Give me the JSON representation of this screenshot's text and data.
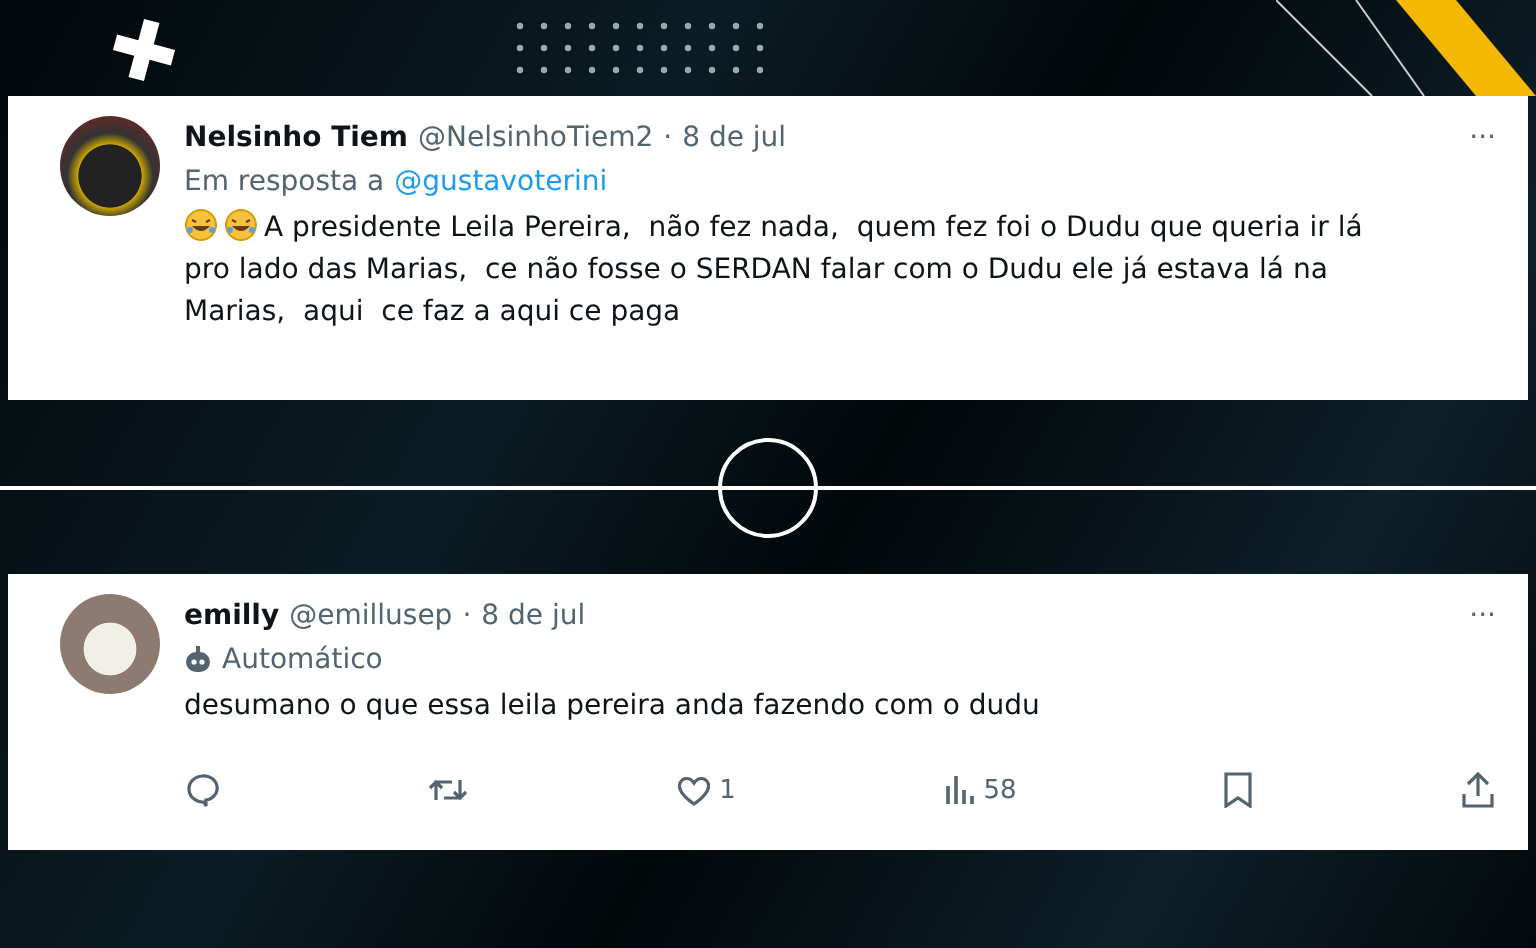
{
  "tweets": [
    {
      "name": "Nelsinho Tiem",
      "handle": "@NelsinhoTiem2",
      "separator": "·",
      "date": "8 de jul",
      "more": "···",
      "reply_prefix": "Em resposta a",
      "reply_mention": "@gustavoterini",
      "lead_icons": [
        {
          "kind": "laughing"
        },
        {
          "kind": "laughing"
        }
      ],
      "text": "A presidente Leila Pereira,  não fez nada,  quem fez foi o Dudu que queria ir lá pro lado das Marias,  ce não fosse o SERDAN falar com o Dudu ele já estava lá na Marias,  aqui  ce faz a aqui ce paga"
    },
    {
      "name": "emilly",
      "handle": "@emillusep",
      "separator": "·",
      "date": "8 de jul",
      "more": "···",
      "automated": "Automático",
      "text": "desumano o que essa leila pereira anda fazendo com o dudu",
      "actions": [
        {
          "kind": "reply"
        },
        {
          "kind": "repost"
        },
        {
          "kind": "like",
          "count": "1"
        },
        {
          "kind": "views",
          "count": "58"
        },
        {
          "kind": "bookmark"
        },
        {
          "kind": "share"
        }
      ]
    }
  ]
}
